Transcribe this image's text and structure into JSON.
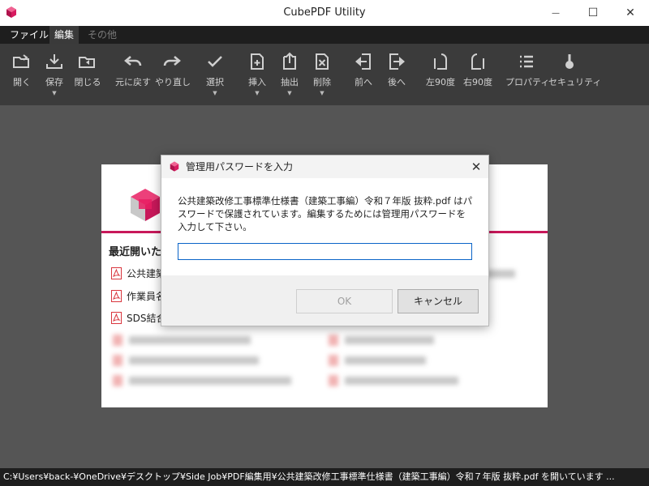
{
  "window": {
    "title": "CubePDF Utility",
    "controls": {
      "minimize": "—",
      "maximize": "☐",
      "close": "✕"
    }
  },
  "menu": {
    "items": [
      {
        "label": "ファイル",
        "state": "normal"
      },
      {
        "label": "編集",
        "state": "active"
      },
      {
        "label": "その他",
        "state": "disabled"
      }
    ]
  },
  "toolbar": {
    "tools": [
      {
        "label": "開く",
        "icon": "open-folder-icon",
        "dropdown": ""
      },
      {
        "label": "保存",
        "icon": "save-download-icon",
        "dropdown": "▼"
      },
      {
        "label": "閉じる",
        "icon": "close-folder-icon",
        "dropdown": ""
      },
      {
        "label": "元に戻す",
        "icon": "undo-icon",
        "dropdown": ""
      },
      {
        "label": "やり直し",
        "icon": "redo-icon",
        "dropdown": ""
      },
      {
        "label": "選択",
        "icon": "checkmark-icon",
        "dropdown": "▼"
      },
      {
        "label": "挿入",
        "icon": "insert-page-icon",
        "dropdown": "▼"
      },
      {
        "label": "抽出",
        "icon": "extract-icon",
        "dropdown": "▼"
      },
      {
        "label": "削除",
        "icon": "delete-page-icon",
        "dropdown": "▼"
      },
      {
        "label": "前へ",
        "icon": "move-previous-icon",
        "dropdown": ""
      },
      {
        "label": "後へ",
        "icon": "move-next-icon",
        "dropdown": ""
      },
      {
        "label": "左90度",
        "icon": "rotate-left-icon",
        "dropdown": ""
      },
      {
        "label": "右90度",
        "icon": "rotate-right-icon",
        "dropdown": ""
      },
      {
        "label": "プロパティ",
        "icon": "properties-list-icon",
        "dropdown": ""
      },
      {
        "label": "セキュリティ",
        "icon": "lock-key-icon",
        "dropdown": ""
      }
    ]
  },
  "recent": {
    "heading": "最近開いた",
    "items": [
      {
        "label": "公共建築"
      },
      {
        "label": "作業員名"
      },
      {
        "label": "SDS結合"
      }
    ]
  },
  "dialog": {
    "title": "管理用パスワードを入力",
    "message": "公共建築改修工事標準仕様書（建築工事編）令和７年版 抜粋.pdf はパスワードで保護されています。編集するためには管理用パスワードを入力して下さい。",
    "password_value": "",
    "ok_label": "OK",
    "cancel_label": "キャンセル",
    "close_glyph": "✕"
  },
  "status": {
    "text": "C:¥Users¥back-¥OneDrive¥デスクトップ¥Side Job¥PDF編集用¥公共建築改修工事標準仕様書（建築工事編）令和７年版 抜粋.pdf を開いています ..."
  },
  "colors": {
    "brand": "#c8185a",
    "toolbar_bg": "#3b3b3b",
    "menubar_bg": "#1e1e1e",
    "workspace_bg": "#555555",
    "input_focus": "#0a64c8"
  }
}
